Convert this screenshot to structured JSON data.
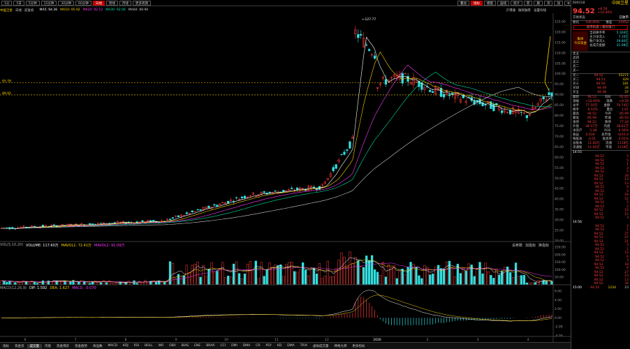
{
  "toolbar": {
    "buttons": [
      "1分",
      "5日",
      "5分钟",
      "15分钟",
      "30分钟",
      "60分钟",
      "日线",
      "周线",
      "月线",
      "更多周期"
    ],
    "active": "日线",
    "right_buttons": [
      "叠加",
      "指标",
      "模版",
      "画线",
      "统计",
      "箭",
      "删",
      "添",
      "加",
      "⚙"
    ],
    "right_active": "指标"
  },
  "info": {
    "stock_name": "中国卫星",
    "tags": [
      "日线",
      "前复权"
    ],
    "ma_items": [
      {
        "label": "MA5: 94.36",
        "color": "#ffffff"
      },
      {
        "label": "MA10: 95.92",
        "color": "#ffd400"
      },
      {
        "label": "MA20: 92.12",
        "color": "#ff3bff"
      },
      {
        "label": "MA30: 92.06",
        "color": "#00e0a0"
      },
      {
        "label": "MA60: 89.96",
        "color": "#cccccc"
      }
    ],
    "right_links": [
      "沪港通",
      "融资融券",
      "设置均线"
    ]
  },
  "price_axis": [
    "125.00",
    "120.00",
    "115.00",
    "110.00",
    "105.00",
    "100.00",
    "95.00",
    "90.00",
    "85.00",
    "80.00",
    "75.00",
    "70.00",
    "65.00",
    "60.00",
    "55.00",
    "50.00",
    "45.00",
    "40.00",
    "35.00",
    "30.00",
    "25.00",
    "20.00"
  ],
  "price_levels": [
    {
      "value": "95.78"
    },
    {
      "value": "89.92"
    }
  ],
  "peak_label": "127.77",
  "volume_panel": {
    "title": "VOL(5,10,20)",
    "items": [
      {
        "label": "VOLUME: 117.60万",
        "color": "#ffffff"
      },
      {
        "label": "MAVOL1: 72.41万",
        "color": "#ffd400"
      },
      {
        "label": "MAVOL2: 91.09万",
        "color": "#ff3bff"
      }
    ],
    "links": [
      "设参数",
      "加指标",
      "换指标"
    ],
    "axis": [
      "250.00",
      "200.00",
      "150.00",
      "100.00",
      "50.00"
    ]
  },
  "macd_panel": {
    "title": "MACD(12,26,9)",
    "items": [
      {
        "label": "DIF: 1.592",
        "color": "#ffffff"
      },
      {
        "label": "DEA: 1.627",
        "color": "#ffd400"
      },
      {
        "label": "MACD: -0.070",
        "color": "#ff3bff"
      }
    ],
    "links": [
      "设参数",
      "加指标",
      "换指标"
    ],
    "axis": [
      "6.00",
      "4.00",
      "2.00",
      "0.00",
      "-2.00",
      "-4.00"
    ]
  },
  "date_axis": {
    "label": "2026",
    "marks": [
      "6",
      "7",
      "8",
      "9",
      "10",
      "11",
      "12",
      "2026",
      "2",
      "3",
      "4"
    ]
  },
  "bottom_tabs": [
    "指标",
    "资金流",
    "成交量",
    "内盘",
    "资金博弈",
    "资金趋势",
    "商品数",
    "MACD",
    "KDJ",
    "RSI",
    "BOLL",
    "WR",
    "OBV",
    "BIAS",
    "ENE",
    "BRAR",
    "CCI",
    "DMI",
    "DMA",
    "CR",
    "PSY",
    "KD",
    "DMA",
    "TRIX",
    "虚拟成交量",
    "神奇九转",
    "更多指标"
  ],
  "bottom_active": "成交量",
  "quote": {
    "code": "600118",
    "name": "中国卫星",
    "price": "94.52",
    "change": "+8.59",
    "change_pct": "+10.00%",
    "status_label": "交易状态",
    "status": "已收市",
    "webi_label": "委比",
    "webi": "100.00%",
    "wecha_label": "委差",
    "wecha": "55952",
    "ad_text": "退市机会 | 看好尾门",
    "fund_title": "集体",
    "fund_sub": "今日资金",
    "fund_rows": [
      {
        "k": "当前换手率",
        "v": "5.304亿"
      },
      {
        "k": "主力净流入",
        "v": "7.10亿"
      },
      {
        "k": "散户净流入",
        "v": "39.80亿"
      },
      {
        "k": "总成交金额",
        "v": "31.98亿"
      }
    ],
    "sell_orders": [
      {
        "k": "卖五",
        "p": "",
        "v": ""
      },
      {
        "k": "卖四",
        "p": "",
        "v": ""
      },
      {
        "k": "卖三",
        "p": "",
        "v": ""
      },
      {
        "k": "卖二",
        "p": "",
        "v": ""
      },
      {
        "k": "卖一",
        "p": "",
        "v": ""
      }
    ],
    "buy_orders": [
      {
        "k": "买一",
        "p": "94.52",
        "v": "55271"
      },
      {
        "k": "买二",
        "p": "94.51",
        "v": "429"
      },
      {
        "k": "买三",
        "p": "94.50",
        "v": "181"
      },
      {
        "k": "买四",
        "p": "94.49",
        "v": "34"
      },
      {
        "k": "买五",
        "p": "94.48",
        "v": "37"
      }
    ],
    "stats": [
      {
        "k": "最新",
        "v": "94.52",
        "k2": "均价",
        "v2": "91.65"
      },
      {
        "k": "涨幅",
        "v": "+10.00%",
        "k2": "涨跌",
        "v2": "+8.59"
      },
      {
        "k": "总手",
        "v": "77.18万",
        "k2": "金额",
        "v2": "70.74亿"
      },
      {
        "k": "换手",
        "v": "6.53%",
        "k2": "量比",
        "v2": "1.61"
      },
      {
        "k": "最高",
        "v": "94.52",
        "k2": "今开",
        "v2": "85.99"
      },
      {
        "k": "最低",
        "v": "85.99",
        "k2": "昨收",
        "v2": "85.93"
      },
      {
        "k": "涨停",
        "v": "94.52",
        "k2": "跌停",
        "v2": "77.34"
      },
      {
        "k": "外盘",
        "v": "38.57万",
        "k2": "内盘",
        "v2": "38.61万"
      },
      {
        "k": "净资产",
        "v": "5.38",
        "k2": "ROE",
        "v2": "0.56%"
      },
      {
        "k": "收益",
        "v": "0.030",
        "k2": "总市值",
        "v2": "3143.4"
      },
      {
        "k": "每股净",
        "v": "0.01",
        "k2": "股息率",
        "v2": "0.01%"
      },
      {
        "k": "总股本",
        "v": "11.82亿",
        "k2": "流通",
        "v2": "1118亿"
      },
      {
        "k": "流通股",
        "v": "11.82亿",
        "k2": "市值",
        "v2": "1118亿"
      }
    ],
    "ticks_a_time": "14:55",
    "ticks_b_time": "14:56",
    "ticks_end_time": "15:00",
    "ticks_a": [
      {
        "p": "94.52",
        "v": "5"
      },
      {
        "p": "94.52",
        "v": "5"
      },
      {
        "p": "94.52",
        "v": "1"
      },
      {
        "p": "94.52",
        "v": "3"
      },
      {
        "p": "94.52",
        "v": "5"
      },
      {
        "p": "94.52",
        "v": "34"
      },
      {
        "p": "94.52",
        "v": "13"
      },
      {
        "p": "94.52",
        "v": "13"
      },
      {
        "p": "94.52",
        "v": "6"
      },
      {
        "p": "94.52",
        "v": "5"
      },
      {
        "p": "94.52",
        "v": "18"
      },
      {
        "p": "94.52",
        "v": "52"
      },
      {
        "p": "94.52",
        "v": "5"
      },
      {
        "p": "94.52",
        "v": "2"
      },
      {
        "p": "94.52",
        "v": "10"
      },
      {
        "p": "94.52",
        "v": "15"
      },
      {
        "p": "94.52",
        "v": "3"
      }
    ],
    "ticks_b": [
      {
        "p": "94.52",
        "v": "3"
      },
      {
        "p": "94.52",
        "v": "1"
      },
      {
        "p": "94.52",
        "v": "27"
      },
      {
        "p": "94.52",
        "v": "47"
      },
      {
        "p": "94.52",
        "v": "21"
      },
      {
        "p": "94.52",
        "v": "5"
      },
      {
        "p": "94.52",
        "v": "1"
      },
      {
        "p": "94.52",
        "v": "12"
      },
      {
        "p": "94.52",
        "v": "6"
      },
      {
        "p": "94.52",
        "v": "3"
      },
      {
        "p": "94.52",
        "v": "18"
      },
      {
        "p": "94.52",
        "v": "6"
      },
      {
        "p": "94.52",
        "v": "27"
      },
      {
        "p": "94.52",
        "v": "23"
      },
      {
        "p": "94.52",
        "v": "13"
      },
      {
        "p": "94.52",
        "v": "34"
      }
    ],
    "ticks_end": {
      "p": "94.52",
      "v": "1234",
      "n": "23"
    }
  },
  "colors": {
    "up": "#ff3b3b",
    "down": "#33e0e0",
    "ma5": "#ffffff",
    "ma10": "#ffd400",
    "ma20": "#ff3bff",
    "ma30": "#00e0a0",
    "ma60": "#cccccc"
  }
}
